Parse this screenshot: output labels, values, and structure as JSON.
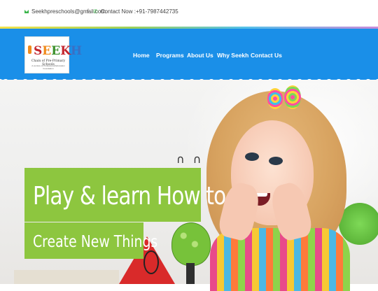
{
  "topbar": {
    "email": "Seekhpreschools@gmail.com",
    "separator": "/",
    "phone": "Contact Now :+91-7987442735",
    "email_icon": "envelope-icon",
    "phone_icon": "phone-icon"
  },
  "logo": {
    "brand_letters": [
      "S",
      "E",
      "E",
      "K",
      "H"
    ],
    "subtitle": "Chain of Pre-Primary Schools",
    "tagline": "A venture of Professional Education Foundation"
  },
  "nav": {
    "items": [
      {
        "label": "Home"
      },
      {
        "label": "Programs"
      },
      {
        "label": "About Us"
      },
      {
        "label": "Why Seekh"
      },
      {
        "label": "Contact Us"
      }
    ]
  },
  "hero": {
    "headline_line1": "Play & learn How to",
    "headline_line2": "Create New Things"
  },
  "colors": {
    "nav_blue": "#1a8fe8",
    "banner_green": "#8dc63f",
    "icon_green": "#3ab54a"
  }
}
